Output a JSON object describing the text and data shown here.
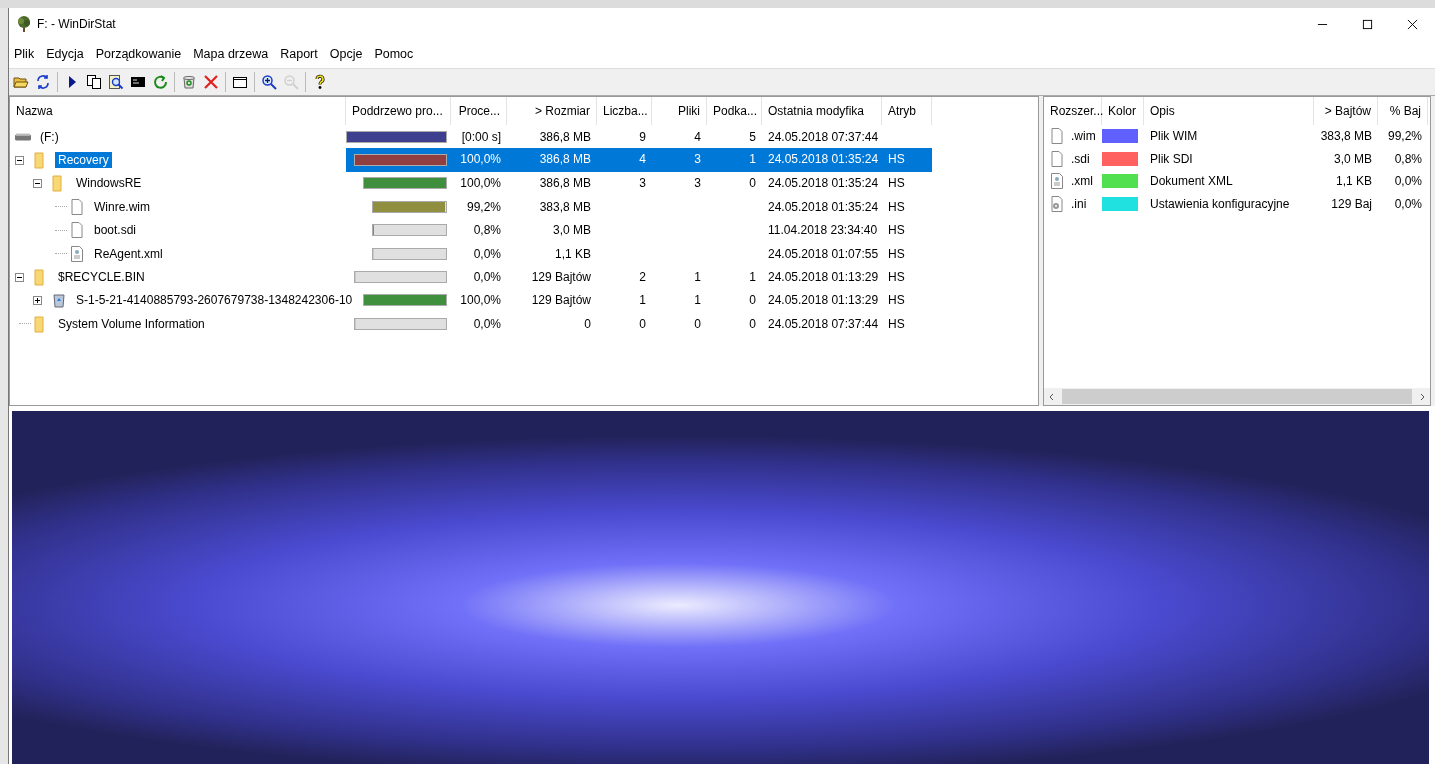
{
  "window": {
    "title": "F: - WinDirStat"
  },
  "menu": [
    "Plik",
    "Edycja",
    "Porządkowanie",
    "Mapa drzewa",
    "Raport",
    "Opcje",
    "Pomoc"
  ],
  "toolbar": [
    {
      "kind": "open",
      "disabled": false
    },
    {
      "kind": "refresh",
      "disabled": false
    },
    {
      "kind": "sep"
    },
    {
      "kind": "play",
      "disabled": false
    },
    {
      "kind": "copy",
      "disabled": false
    },
    {
      "kind": "explore",
      "disabled": false
    },
    {
      "kind": "console",
      "disabled": false
    },
    {
      "kind": "reload",
      "disabled": false
    },
    {
      "kind": "sep"
    },
    {
      "kind": "recycle",
      "disabled": false
    },
    {
      "kind": "delete",
      "disabled": false
    },
    {
      "kind": "sep"
    },
    {
      "kind": "properties",
      "disabled": false
    },
    {
      "kind": "sep"
    },
    {
      "kind": "zoomin",
      "disabled": false
    },
    {
      "kind": "zoomout",
      "disabled": true
    },
    {
      "kind": "sep"
    },
    {
      "kind": "help",
      "disabled": false
    }
  ],
  "tree": {
    "columns": [
      "Nazwa",
      "Poddrzewo pro...",
      "Proce...",
      "> Rozmiar",
      "Liczba...",
      "Pliki",
      "Podka...",
      "Ostatnia modyfika",
      "Atryb"
    ],
    "items": [
      {
        "kind": "drive",
        "name": "(F:)",
        "selected": false,
        "level": 1,
        "color": "#3f3f8f",
        "percent": "[0:00 s]",
        "size": "386,8 MB",
        "items": "9",
        "files": "4",
        "subdirs": "5",
        "modified": "24.05.2018  07:37:44",
        "children": [
          {
            "kind": "folder",
            "name": "Recovery",
            "expanded": true,
            "selected": true,
            "level": 1,
            "color": "#8f3f3f",
            "percent": "100,0%",
            "size": "386,8 MB",
            "items": "4",
            "files": "3",
            "subdirs": "1",
            "modified": "24.05.2018  01:35:24",
            "attrib": "HS",
            "children": [
              {
                "kind": "folder",
                "name": "WindowsRE",
                "expanded": true,
                "selected": false,
                "level": 1,
                "color": "#3f8f3f",
                "percent": "100,0%",
                "size": "386,8 MB",
                "items": "3",
                "files": "3",
                "subdirs": "0",
                "modified": "24.05.2018  01:35:24",
                "attrib": "HS",
                "children": [
                  {
                    "kind": "file",
                    "name": "Winre.wim",
                    "selected": false,
                    "level": 0.992,
                    "color": "#8f8f3f",
                    "percent": "99,2%",
                    "size": "383,8 MB",
                    "modified": "24.05.2018  01:35:24",
                    "attrib": "HS"
                  },
                  {
                    "kind": "file",
                    "name": "boot.sdi",
                    "selected": false,
                    "level": 0.008,
                    "color": "#8f8f3f",
                    "percent": "0,8%",
                    "size": "3,0 MB",
                    "modified": "11.04.2018  23:34:40",
                    "attrib": "HS"
                  },
                  {
                    "kind": "xml",
                    "name": "ReAgent.xml",
                    "selected": false,
                    "level": 0,
                    "percent": "0,0%",
                    "size": "1,1 KB",
                    "modified": "24.05.2018  01:07:55",
                    "attrib": "HS"
                  }
                ]
              }
            ]
          },
          {
            "kind": "folder",
            "name": "$RECYCLE.BIN",
            "expanded": true,
            "selected": false,
            "level": 0,
            "percent": "0,0%",
            "size": "129 Bajtów",
            "items": "2",
            "files": "1",
            "subdirs": "1",
            "modified": "24.05.2018  01:13:29",
            "attrib": "HS",
            "children": [
              {
                "kind": "recycle",
                "name": "S-1-5-21-4140885793-2607679738-1348242306-10",
                "expanded": false,
                "selected": false,
                "level": 1,
                "color": "#3f8f3f",
                "percent": "100,0%",
                "size": "129 Bajtów",
                "items": "1",
                "files": "1",
                "subdirs": "0",
                "modified": "24.05.2018  01:13:29",
                "attrib": "HS"
              }
            ]
          },
          {
            "kind": "folder",
            "name": "System Volume Information",
            "selected": false,
            "level": 0,
            "percent": "0,0%",
            "size": "0",
            "items": "0",
            "files": "0",
            "subdirs": "0",
            "modified": "24.05.2018  07:37:44",
            "attrib": "HS"
          }
        ]
      }
    ]
  },
  "extensions": {
    "columns": [
      "Rozszer...",
      "Kolor",
      "Opis",
      "> Bajtów",
      "% Baj"
    ],
    "rows": [
      {
        "kind": "file",
        "ext": ".wim",
        "color": "#6060ff",
        "description": "Plik WIM",
        "bytes": "383,8 MB",
        "percent": "99,2%"
      },
      {
        "kind": "file",
        "ext": ".sdi",
        "color": "#ff6060",
        "description": "Plik SDI",
        "bytes": "3,0 MB",
        "percent": "0,8%"
      },
      {
        "kind": "xml",
        "ext": ".xml",
        "color": "#50e050",
        "description": "Dokument XML",
        "bytes": "1,1 KB",
        "percent": "0,0%"
      },
      {
        "kind": "ini",
        "ext": ".ini",
        "color": "#20e0e0",
        "description": "Ustawienia konfiguracyjne",
        "bytes": "129 Baj",
        "percent": "0,0%"
      }
    ]
  }
}
